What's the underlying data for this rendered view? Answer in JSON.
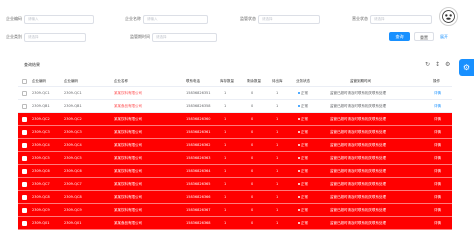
{
  "filters": {
    "company_code": {
      "label": "企业编码",
      "placeholder": "请输入"
    },
    "company_name": {
      "label": "企业名称",
      "placeholder": "请输入"
    },
    "supervision_status": {
      "label": "监管状态",
      "placeholder": "请选择"
    },
    "business_status": {
      "label": "营业状态",
      "placeholder": "请选择"
    },
    "enterprise_type": {
      "label": "企业类别",
      "placeholder": "请选择"
    },
    "time": {
      "label": "监管期时间",
      "placeholder": "请选择"
    }
  },
  "actions": {
    "query": "查询",
    "reset": "重置",
    "expand": "展开"
  },
  "result": {
    "title": "查询结果"
  },
  "table": {
    "headers": [
      "企业编码",
      "企业编码",
      "企业名称",
      "联系电话",
      "库存数量",
      "剩余数量",
      "待出库",
      "业务状态",
      "监管到期时间",
      "操作"
    ],
    "rows": [
      {
        "code": "2309-QC1",
        "name": "某某饮料有限公司",
        "phone": "15836826351",
        "qty": "1",
        "remain": "0",
        "pending": "1",
        "status": "正常",
        "date": "监管已超时请及时联系相关联系处理",
        "op": "详情",
        "highlight": false
      },
      {
        "code": "2309-QB1",
        "name": "某某食品有限公司",
        "phone": "15836826358",
        "qty": "1",
        "remain": "0",
        "pending": "1",
        "status": "正常",
        "date": "监管已超时请及时联系相关联系处理",
        "op": "详情",
        "highlight": false
      },
      {
        "code": "2309-QC2",
        "name": "某某饮料有限公司",
        "phone": "15836826360",
        "qty": "1",
        "remain": "0",
        "pending": "1",
        "status": "正常",
        "date": "监管已超时请及时联系相关联系处理",
        "op": "详情",
        "highlight": true
      },
      {
        "code": "2309-QC3",
        "name": "某某饮料有限公司",
        "phone": "15836826361",
        "qty": "1",
        "remain": "0",
        "pending": "1",
        "status": "正常",
        "date": "监管已超时请及时联系相关联系处理",
        "op": "详情",
        "highlight": true
      },
      {
        "code": "2309-QC4",
        "name": "某某饮料有限公司",
        "phone": "15836826362",
        "qty": "1",
        "remain": "0",
        "pending": "1",
        "status": "正常",
        "date": "监管已超时请及时联系相关联系处理",
        "op": "详情",
        "highlight": true
      },
      {
        "code": "2309-QC5",
        "name": "某某饮料有限公司",
        "phone": "15836826363",
        "qty": "1",
        "remain": "0",
        "pending": "1",
        "status": "正常",
        "date": "监管已超时请及时联系相关联系处理",
        "op": "详情",
        "highlight": true
      },
      {
        "code": "2309-QC6",
        "name": "某某饮料有限公司",
        "phone": "15836826364",
        "qty": "1",
        "remain": "0",
        "pending": "1",
        "status": "正常",
        "date": "监管已超时请及时联系相关联系处理",
        "op": "详情",
        "highlight": true
      },
      {
        "code": "2309-QC7",
        "name": "某某饮料有限公司",
        "phone": "15836826365",
        "qty": "1",
        "remain": "0",
        "pending": "1",
        "status": "正常",
        "date": "监管已超时请及时联系相关联系处理",
        "op": "详情",
        "highlight": true
      },
      {
        "code": "2309-QC8",
        "name": "某某饮料有限公司",
        "phone": "15836826366",
        "qty": "1",
        "remain": "0",
        "pending": "1",
        "status": "正常",
        "date": "监管已超时请及时联系相关联系处理",
        "op": "详情",
        "highlight": true
      },
      {
        "code": "2309-QC9",
        "name": "某某饮料有限公司",
        "phone": "15836826367",
        "qty": "1",
        "remain": "0",
        "pending": "1",
        "status": "正常",
        "date": "监管已超时请及时联系相关联系处理",
        "op": "详情",
        "highlight": true
      },
      {
        "code": "2309-Q01",
        "name": "某某食品有限公司",
        "phone": "15836826368",
        "qty": "1",
        "remain": "0",
        "pending": "1",
        "status": "正常",
        "date": "监管已超时请及时联系相关联系处理",
        "op": "详情",
        "highlight": true
      }
    ]
  },
  "watermark": "CSDN @Jolyne_Tesla",
  "icons": {
    "refresh": "refresh-icon",
    "density": "column-height-icon",
    "settings": "setting-icon",
    "avatar": "avatar-icon",
    "side": "setting-icon"
  },
  "colors": {
    "primary": "#1890ff",
    "highlight": "#ff0000",
    "danger": "#ff4d4f"
  }
}
